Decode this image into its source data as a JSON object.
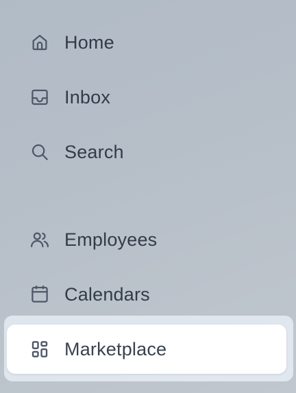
{
  "sidebar": {
    "items": [
      {
        "label": "Home",
        "icon": "home-icon"
      },
      {
        "label": "Inbox",
        "icon": "inbox-icon"
      },
      {
        "label": "Search",
        "icon": "search-icon"
      },
      {
        "label": "Employees",
        "icon": "users-icon"
      },
      {
        "label": "Calendars",
        "icon": "calendar-icon"
      },
      {
        "label": "Marketplace",
        "icon": "grid-icon",
        "active": true
      }
    ]
  },
  "colors": {
    "text": "#323b47",
    "icon": "#4d5766",
    "active_bg": "#ffffff",
    "active_halo": "#ecf2f8",
    "background": "#b6bfc8"
  }
}
